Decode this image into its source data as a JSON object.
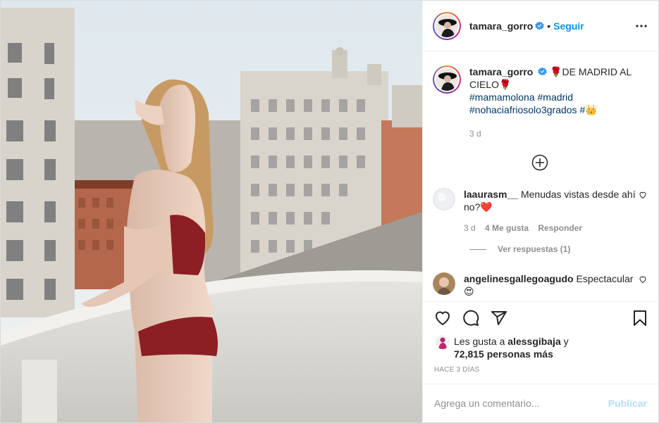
{
  "post": {
    "username": "tamara_gorro",
    "follow_label": "Seguir",
    "separator": "•",
    "caption": {
      "text_part1": "🌹DE MADRID AL CIELO🌹",
      "hashtag1": "#mamamolona",
      "hashtag2": "#madrid",
      "hashtag3": "#nohaciafriosolo3grados",
      "hashtag4": "#👑",
      "age": "3 d"
    },
    "comments": [
      {
        "username": "laaurasm__",
        "text": "Menudas vistas desde ahí no?❤️",
        "age": "3 d",
        "likes": "4 Me gusta",
        "reply_label": "Responder",
        "view_replies": "Ver respuestas (1)"
      },
      {
        "username": "angelinesgallegoagudo",
        "text": "Espectacular😍"
      }
    ],
    "likes": {
      "prefix": "Les gusta a",
      "liker": "alessgibaja",
      "and": "y",
      "others": "72,815 personas más"
    },
    "timestamp": "HACE 3 DÍAS",
    "comment_placeholder": "Agrega un comentario...",
    "publish_label": "Publicar"
  },
  "colors": {
    "link_blue": "#0095f6",
    "hashtag": "#00376b",
    "muted": "#8e8e8e",
    "publish_disabled": "#b2dffc",
    "verified": "#3897f0"
  },
  "icons": [
    "verified-icon",
    "more-options-icon",
    "load-more-icon",
    "heart-icon",
    "comment-icon",
    "share-icon",
    "bookmark-icon"
  ]
}
